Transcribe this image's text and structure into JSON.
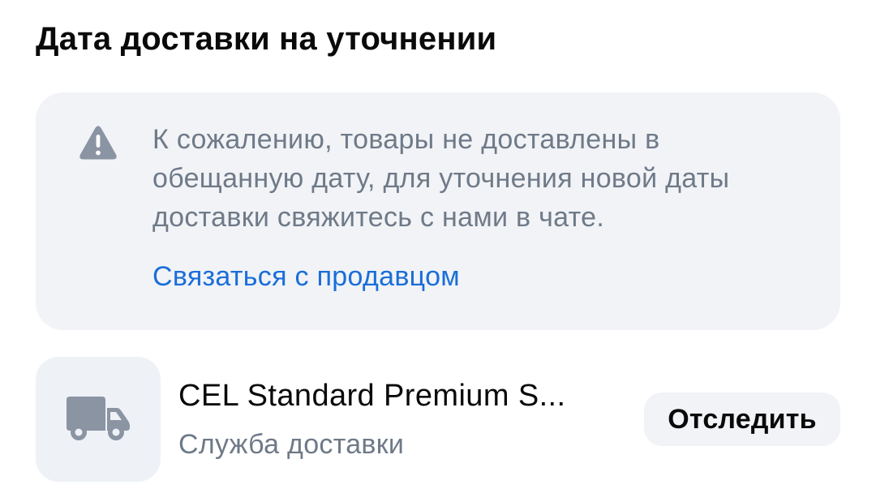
{
  "page": {
    "title": "Дата доставки на уточнении"
  },
  "notice": {
    "icon": "warning-icon",
    "message": "К сожалению, товары не доставлены в обещанную дату, для уточнения новой даты доставки свяжитесь с нами в чате.",
    "contact_link": "Связаться с продавцом"
  },
  "delivery": {
    "icon": "truck-icon",
    "carrier_name": "CEL Standard Premium S...",
    "carrier_subtitle": "Служба доставки",
    "track_button": "Отследить"
  },
  "colors": {
    "notice_background": "#f1f3f7",
    "muted_text": "#6f7a88",
    "link": "#1a6ed8",
    "icon_gray": "#8a94a3"
  }
}
